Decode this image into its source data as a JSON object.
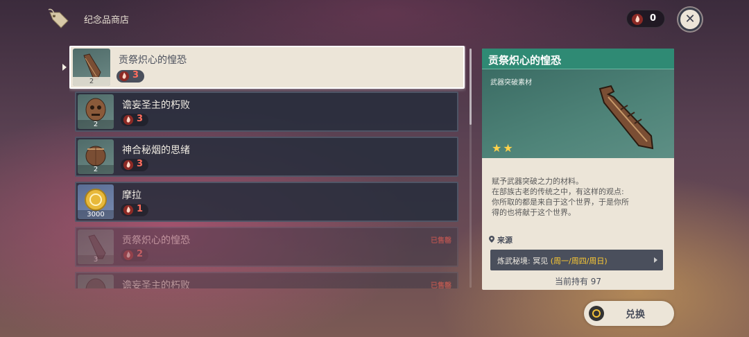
{
  "header": {
    "title": "纪念品商店",
    "currency_count": "0"
  },
  "items": [
    {
      "name": "贡祭炽心的惶恐",
      "qty": "2",
      "price": "3",
      "state": "selected"
    },
    {
      "name": "谵妄圣主的朽败",
      "qty": "2",
      "price": "3",
      "state": "normal"
    },
    {
      "name": "神合秘烟的思绪",
      "qty": "2",
      "price": "3",
      "state": "normal"
    },
    {
      "name": "摩拉",
      "qty": "3000",
      "price": "1",
      "state": "normal"
    },
    {
      "name": "贡祭炽心的惶恐",
      "qty": "3",
      "price": "2",
      "state": "soldout",
      "sold_label": "已售罄"
    },
    {
      "name": "谵妄圣主的朽败",
      "qty": "",
      "price": "",
      "state": "soldout",
      "sold_label": "已售罄"
    }
  ],
  "detail": {
    "title": "贡祭炽心的惶恐",
    "type": "武器突破素材",
    "stars": "★★",
    "description": [
      "赋予武器突破之力的材料。",
      "在部族古老的传统之中，有这样的观点:",
      "你所取的都是来自于这个世界，于是你所",
      "得的也将献于这个世界。"
    ],
    "source_label": "来源",
    "source_name": "炼武秘境: 冥见",
    "source_days": "(周一/周四/周日)",
    "owned": "当前持有 97"
  },
  "exchange": {
    "label": "兑换"
  },
  "colors": {
    "accent_green": "#2f8a74",
    "panel_cream": "#ece5d8",
    "price_red": "#ff6e5e",
    "star_gold": "#ffd24a"
  }
}
